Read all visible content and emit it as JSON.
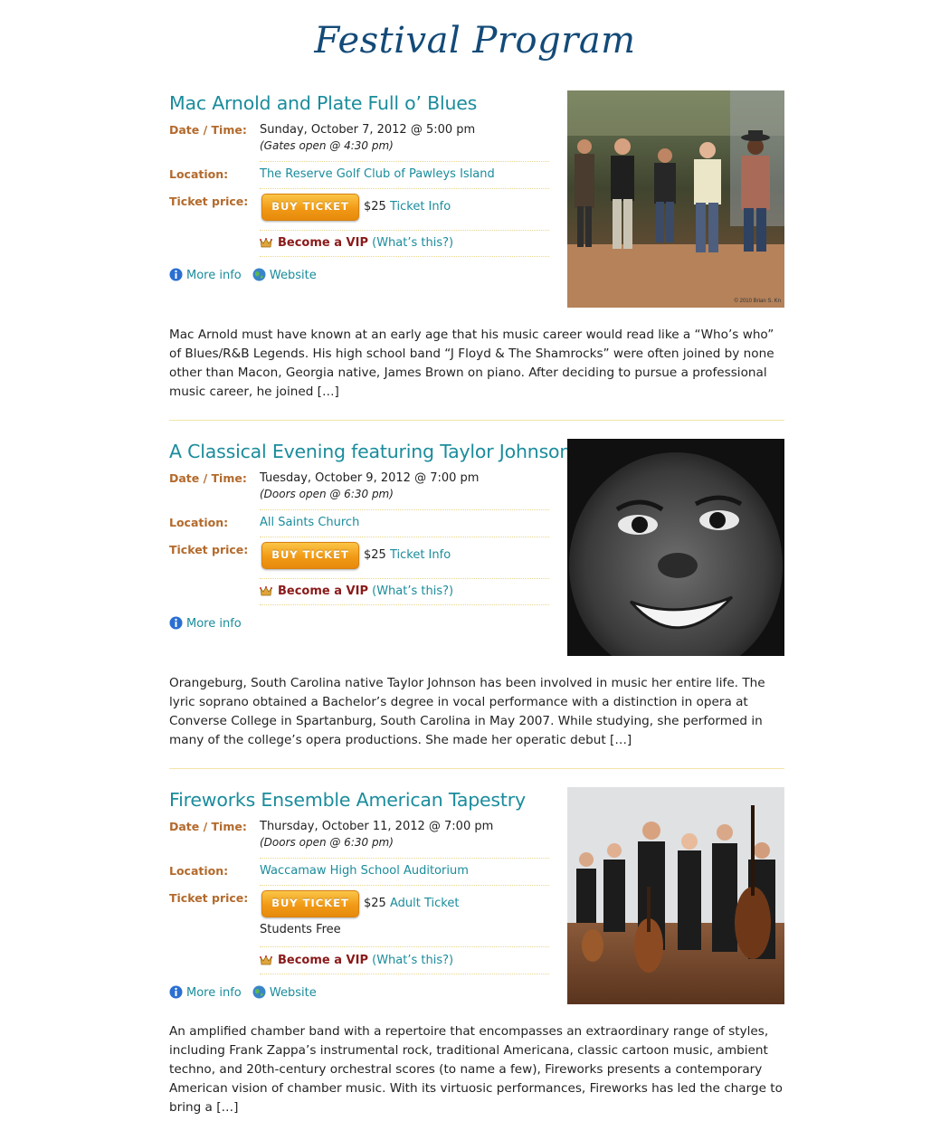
{
  "page": {
    "title": "Festival Program"
  },
  "labels": {
    "date_time": "Date / Time:",
    "location": "Location:",
    "ticket_price": "Ticket price:",
    "buy_ticket": "BUY TICKET",
    "become_vip": "Become a VIP",
    "whats_this": "(What’s this?)",
    "more_info": "More info",
    "website": "Website"
  },
  "events": [
    {
      "title": "Mac Arnold and Plate Full o’ Blues",
      "date": "Sunday, October 7, 2012 @ 5:00 pm",
      "gate_note": "(Gates open @ 4:30 pm)",
      "location": "The Reserve Golf Club of Pawleys Island",
      "price": "$25",
      "ticket_link": "Ticket Info",
      "extra_price_note": "",
      "photo_caption": "© 2010 Brian S. Kn",
      "description": "Mac Arnold must have known at an early age that his music career would read like a “Who’s who” of Blues/R&B Legends. His high school band “J Floyd & The Shamrocks” were often joined by none other than Macon, Georgia native, James Brown on piano. After deciding to pursue a professional music career, he joined […]"
    },
    {
      "title": "A Classical Evening featuring Taylor Johnson",
      "date": "Tuesday, October 9, 2012 @ 7:00 pm",
      "gate_note": "(Doors open @ 6:30 pm)",
      "location": "All Saints Church",
      "price": "$25",
      "ticket_link": "Ticket Info",
      "extra_price_note": "",
      "photo_caption": "",
      "description": "Orangeburg, South Carolina native Taylor Johnson has been involved in music her entire life. The lyric soprano obtained a Bachelor’s degree in vocal performance with a distinction in opera at Converse College in Spartanburg, South Carolina in May 2007. While studying, she performed in many of the college’s opera productions. She made her operatic debut […]"
    },
    {
      "title": "Fireworks Ensemble American Tapestry",
      "date": "Thursday, October 11, 2012 @ 7:00 pm",
      "gate_note": "(Doors open @ 6:30 pm)",
      "location": "Waccamaw High School Auditorium",
      "price": "$25",
      "ticket_link": "Adult Ticket",
      "extra_price_note": "Students Free",
      "photo_caption": "",
      "description": "An amplified chamber band with a repertoire that encompasses an extraordinary range of styles, including Frank Zappa’s instrumental rock, traditional Americana, classic cartoon music, ambient techno, and 20th-century orchestral scores (to name a few), Fireworks presents a contemporary American vision of chamber music. With its virtuosic performances, Fireworks has led the charge to bring a […]"
    }
  ],
  "colors": {
    "title": "#134a78",
    "event_title": "#1a8c9c",
    "label": "#b36a2c",
    "vip": "#8a1a1a",
    "button": "#f19a16",
    "divider": "#f3e4a8"
  },
  "icons": [
    "info-icon",
    "globe-icon",
    "crown-icon"
  ]
}
